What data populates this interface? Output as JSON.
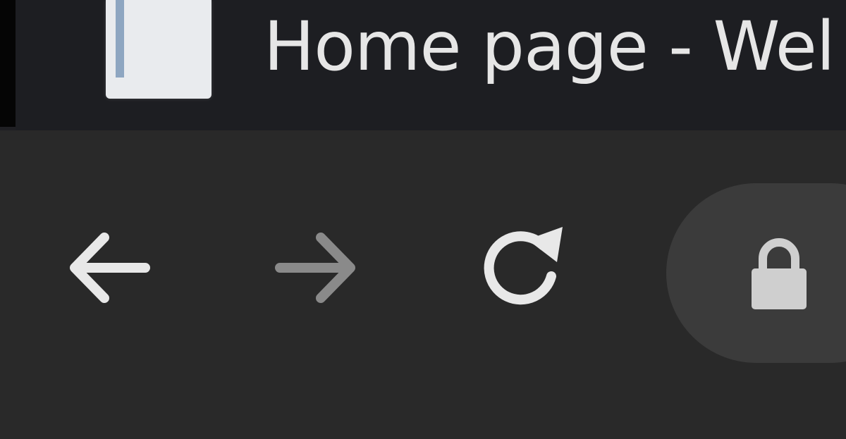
{
  "tab": {
    "title": "Home page - Wel",
    "favicon": "page-icon"
  },
  "toolbar": {
    "back": "back-arrow-icon",
    "forward": "forward-arrow-icon",
    "reload": "reload-icon",
    "omnibox_icon": "lock-icon"
  },
  "colors": {
    "tab_strip": "#1f1f23",
    "toolbar": "#292929",
    "omnibox": "#3b3b3b",
    "icon_active": "#e8e8e8",
    "icon_disabled": "#8a8a8a"
  }
}
